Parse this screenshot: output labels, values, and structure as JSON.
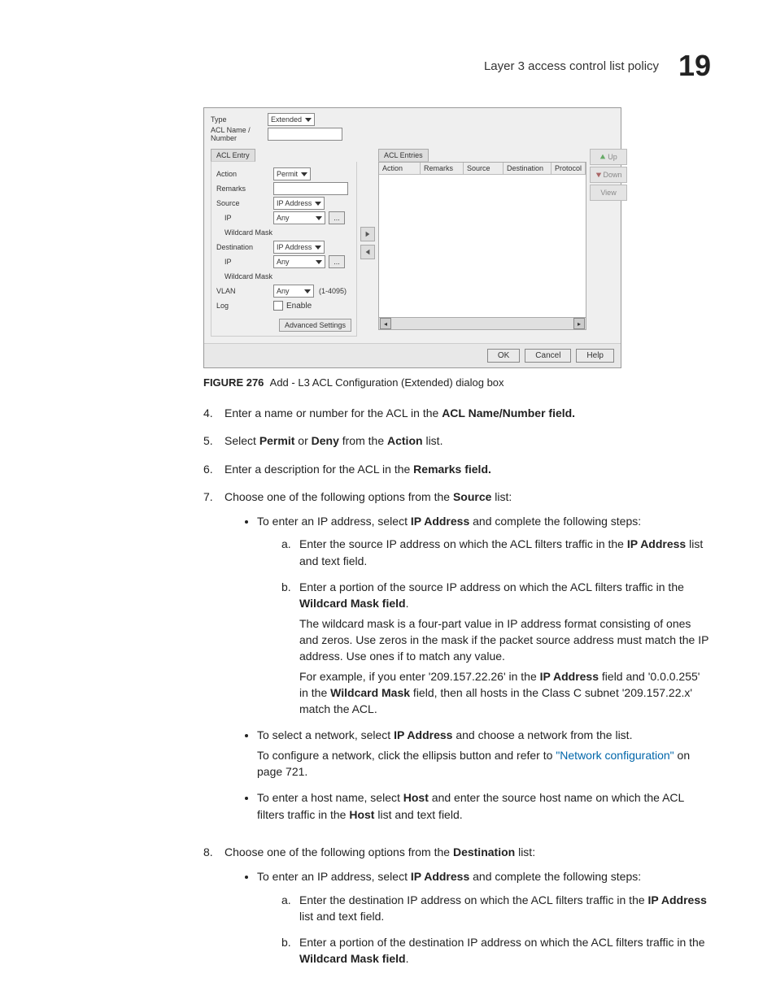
{
  "header": {
    "section": "Layer 3 access control list policy",
    "chapter": "19"
  },
  "dialog": {
    "type_label": "Type",
    "type_value": "Extended",
    "name_label": "ACL Name / Number",
    "tab_entry": "ACL Entry",
    "tab_entries": "ACL Entries",
    "left": {
      "action_label": "Action",
      "action_value": "Permit",
      "remarks_label": "Remarks",
      "source_label": "Source",
      "source_value": "IP Address",
      "ip_label": "IP",
      "ip_value": "Any",
      "wildcard_label": "Wildcard Mask",
      "dest_label": "Destination",
      "dest_value": "IP Address",
      "vlan_label": "VLAN",
      "vlan_value": "Any",
      "vlan_hint": "(1-4095)",
      "log_label": "Log",
      "log_check": "Enable",
      "advanced": "Advanced Settings"
    },
    "table": {
      "cols": [
        "Action",
        "Remarks",
        "Source",
        "Destination",
        "Protocol"
      ]
    },
    "side": {
      "up": "Up",
      "down": "Down",
      "view": "View"
    },
    "footer": {
      "ok": "OK",
      "cancel": "Cancel",
      "help": "Help"
    }
  },
  "caption": {
    "fig": "FIGURE 276",
    "text": "Add - L3 ACL Configuration (Extended) dialog box"
  },
  "steps": {
    "s4": {
      "n": "4.",
      "t1": "Enter a name or number for the ACL in the ",
      "b1": "ACL Name/Number field."
    },
    "s5": {
      "n": "5.",
      "t1": "Select ",
      "b1": "Permit",
      "t2": " or ",
      "b2": "Deny",
      "t3": " from the ",
      "b3": "Action",
      "t4": " list."
    },
    "s6": {
      "n": "6.",
      "t1": "Enter a description for the ACL in the ",
      "b1": "Remarks field."
    },
    "s7": {
      "n": "7.",
      "t1": "Choose one of the following options from the ",
      "b1": "Source",
      "t2": " list:",
      "bullet1": {
        "t1": "To enter an IP address, select ",
        "b1": "IP Address",
        "t2": " and complete the following steps:",
        "a": {
          "l": "a.",
          "t1": "Enter the source IP address on which the ACL filters traffic in the ",
          "b1": "IP Address",
          "t2": " list and text field."
        },
        "b": {
          "l": "b.",
          "t1": "Enter a portion of the source IP address on which the ACL filters traffic in the ",
          "b1": "Wildcard Mask field",
          "t2": ".",
          "p1": "The wildcard mask is a four-part value in IP address format consisting of ones and zeros. Use zeros in the mask if the packet source address must match the IP address. Use ones if to match any value.",
          "p2a": "For example, if you enter '209.157.22.26' in the ",
          "p2b1": "IP Address",
          "p2c": " field and '0.0.0.255' in the ",
          "p2b2": "Wildcard Mask",
          "p2d": " field, then all hosts in the Class C subnet '209.157.22.x' match the ACL."
        }
      },
      "bullet2": {
        "t1": "To select a network, select ",
        "b1": "IP Address",
        "t2": " and choose a network from the list.",
        "p1a": "To configure a network, click the ellipsis button and refer to ",
        "link": "\"Network configuration\"",
        "p1b": " on page 721."
      },
      "bullet3": {
        "t1": "To enter a host name, select ",
        "b1": "Host",
        "t2": " and enter the source host name on which the ACL filters traffic in the ",
        "b2": "Host",
        "t3": " list and text field."
      }
    },
    "s8": {
      "n": "8.",
      "t1": "Choose one of the following options from the ",
      "b1": "Destination",
      "t2": " list:",
      "bullet1": {
        "t1": "To enter an IP address, select ",
        "b1": "IP Address",
        "t2": " and complete the following steps:",
        "a": {
          "l": "a.",
          "t1": "Enter the destination IP address on which the ACL filters traffic in the ",
          "b1": "IP Address",
          "t2": " list and text field."
        },
        "b": {
          "l": "b.",
          "t1": "Enter a portion of the destination IP address on which the ACL filters traffic in the ",
          "b1": "Wildcard Mask field",
          "t2": "."
        }
      }
    }
  }
}
